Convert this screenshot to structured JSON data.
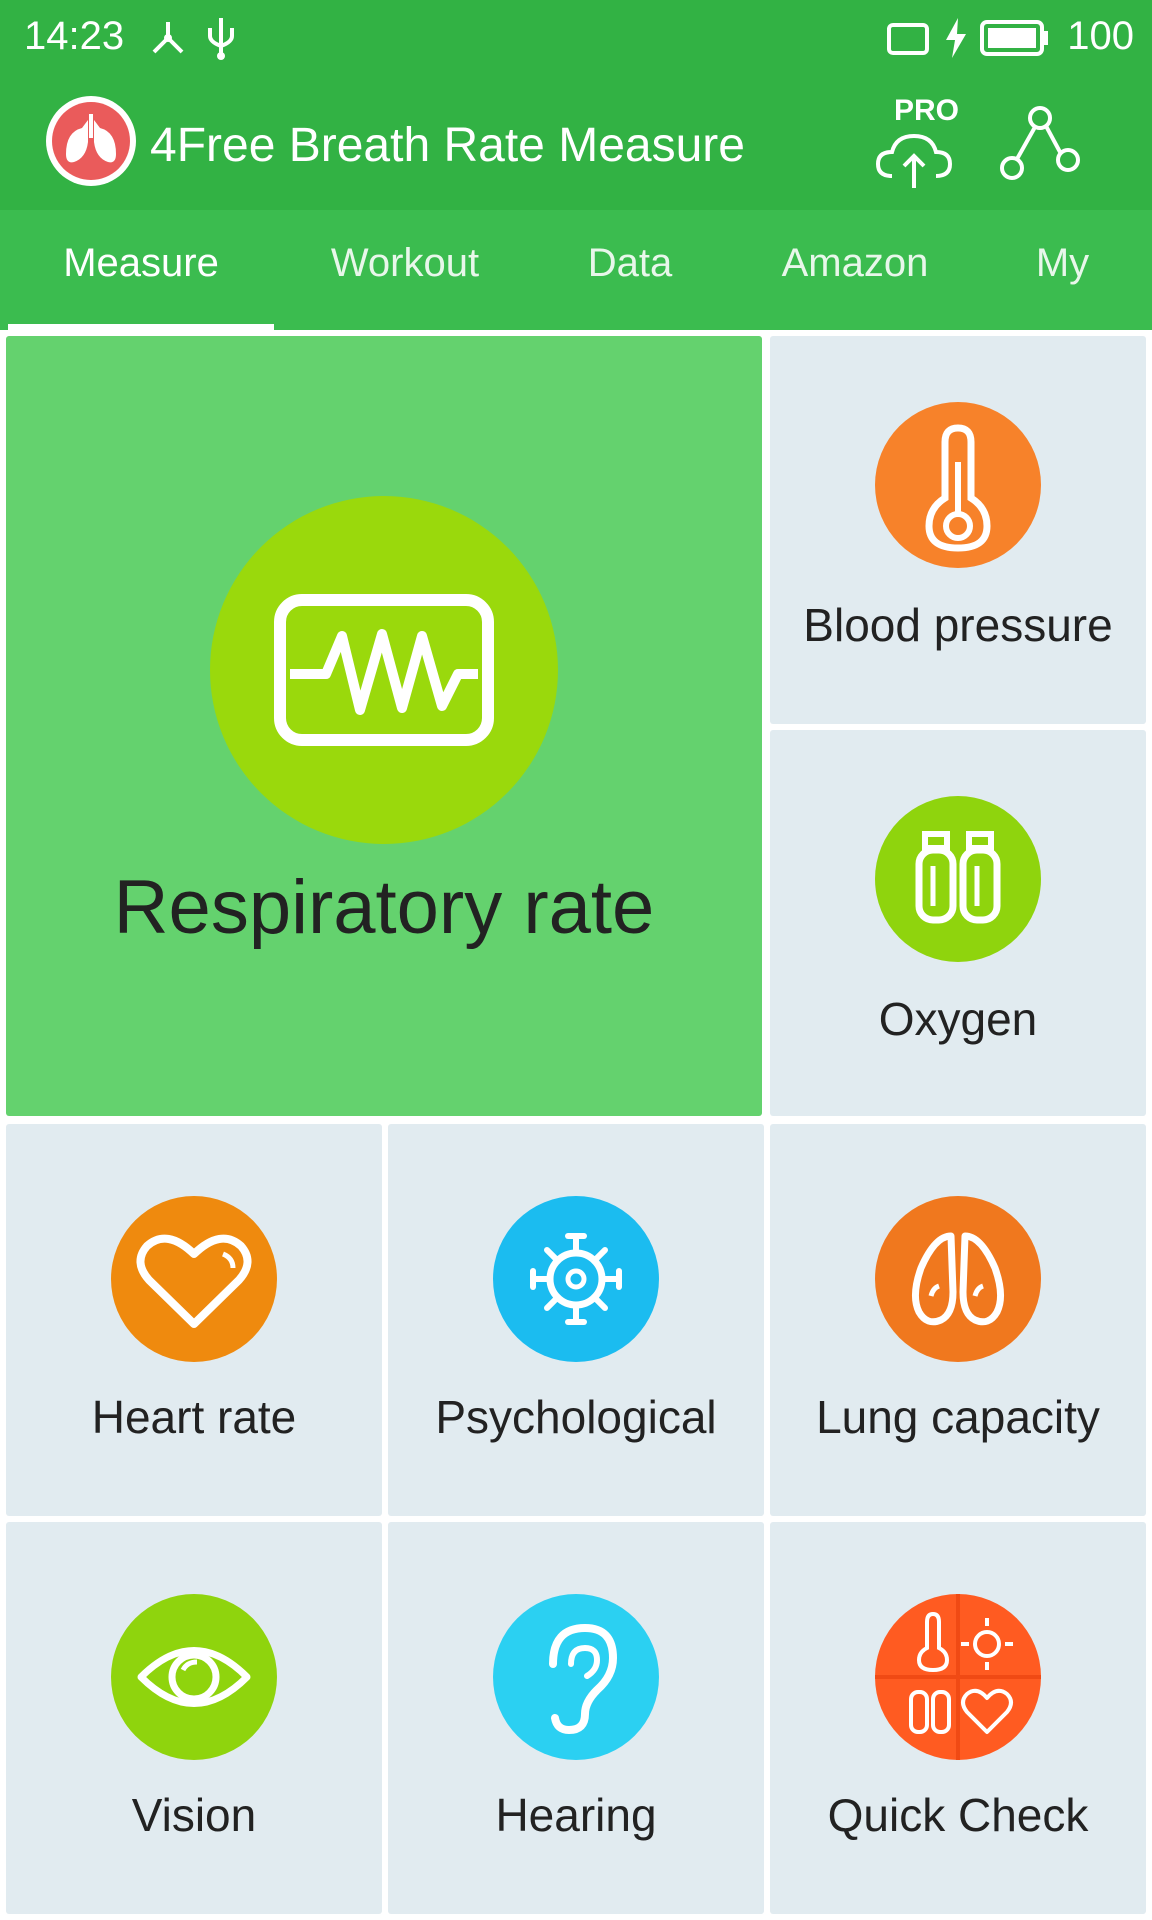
{
  "status_bar": {
    "time": "14:23",
    "battery_level": "100"
  },
  "app_bar": {
    "title": "4Free Breath Rate Measure",
    "pro_label": "PRO"
  },
  "tabs": [
    {
      "label": "Measure",
      "active": true
    },
    {
      "label": "Workout",
      "active": false
    },
    {
      "label": "Data",
      "active": false
    },
    {
      "label": "Amazon",
      "active": false
    },
    {
      "label": "My",
      "active": false
    }
  ],
  "tiles": {
    "respiratory": {
      "label": "Respiratory rate",
      "icon": "ecg-monitor-icon",
      "color": "#9ad90c"
    },
    "blood_pressure": {
      "label": "Blood pressure",
      "icon": "thermometer-icon",
      "color": "#f7822a"
    },
    "oxygen": {
      "label": "Oxygen",
      "icon": "oxygen-tanks-icon",
      "color": "#8fd40d"
    },
    "heart_rate": {
      "label": "Heart rate",
      "icon": "heart-icon",
      "color": "#ef8a0e"
    },
    "psychological": {
      "label": "Psychological",
      "icon": "virus-icon",
      "color": "#1bbcf0"
    },
    "lung_capacity": {
      "label": "Lung capacity",
      "icon": "lungs-icon",
      "color": "#f0781e"
    },
    "vision": {
      "label": "Vision",
      "icon": "eye-icon",
      "color": "#8fd40d"
    },
    "hearing": {
      "label": "Hearing",
      "icon": "ear-icon",
      "color": "#2bd0f2"
    },
    "quick_check": {
      "label": "Quick Check",
      "icon": "quick-check-icon",
      "color": "#ff5b21"
    }
  }
}
